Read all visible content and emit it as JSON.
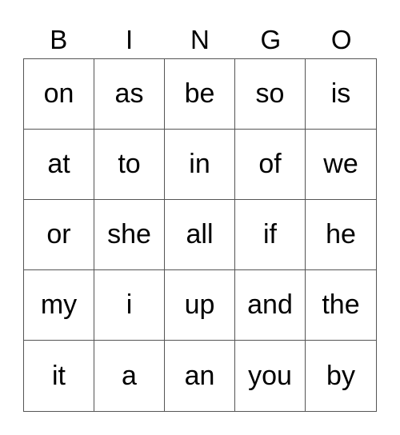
{
  "header": [
    "B",
    "I",
    "N",
    "G",
    "O"
  ],
  "cells": [
    [
      "on",
      "as",
      "be",
      "so",
      "is"
    ],
    [
      "at",
      "to",
      "in",
      "of",
      "we"
    ],
    [
      "or",
      "she",
      "all",
      "if",
      "he"
    ],
    [
      "my",
      "i",
      "up",
      "and",
      "the"
    ],
    [
      "it",
      "a",
      "an",
      "you",
      "by"
    ]
  ]
}
